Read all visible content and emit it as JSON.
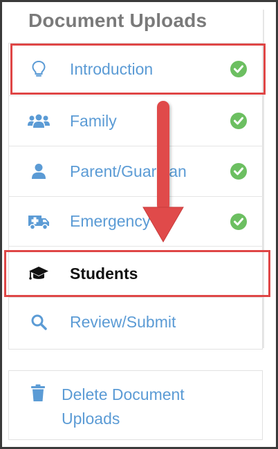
{
  "title": "Document Uploads",
  "items": [
    {
      "label": "Introduction",
      "icon": "lightbulb-icon",
      "done": true
    },
    {
      "label": "Family",
      "icon": "users-icon",
      "done": true
    },
    {
      "label": "Parent/Guardian",
      "icon": "user-icon",
      "done": true
    },
    {
      "label": "Emergency",
      "icon": "ambulance-icon",
      "done": true
    },
    {
      "label": "Students",
      "icon": "graduation-cap-icon",
      "done": false
    },
    {
      "label": "Review/Submit",
      "icon": "search-icon",
      "done": false
    }
  ],
  "delete_label": "Delete Document Uploads",
  "colors": {
    "link": "#5b9bd5",
    "title": "#7a7a7a",
    "check": "#6cbf61",
    "highlight": "#df4646"
  }
}
